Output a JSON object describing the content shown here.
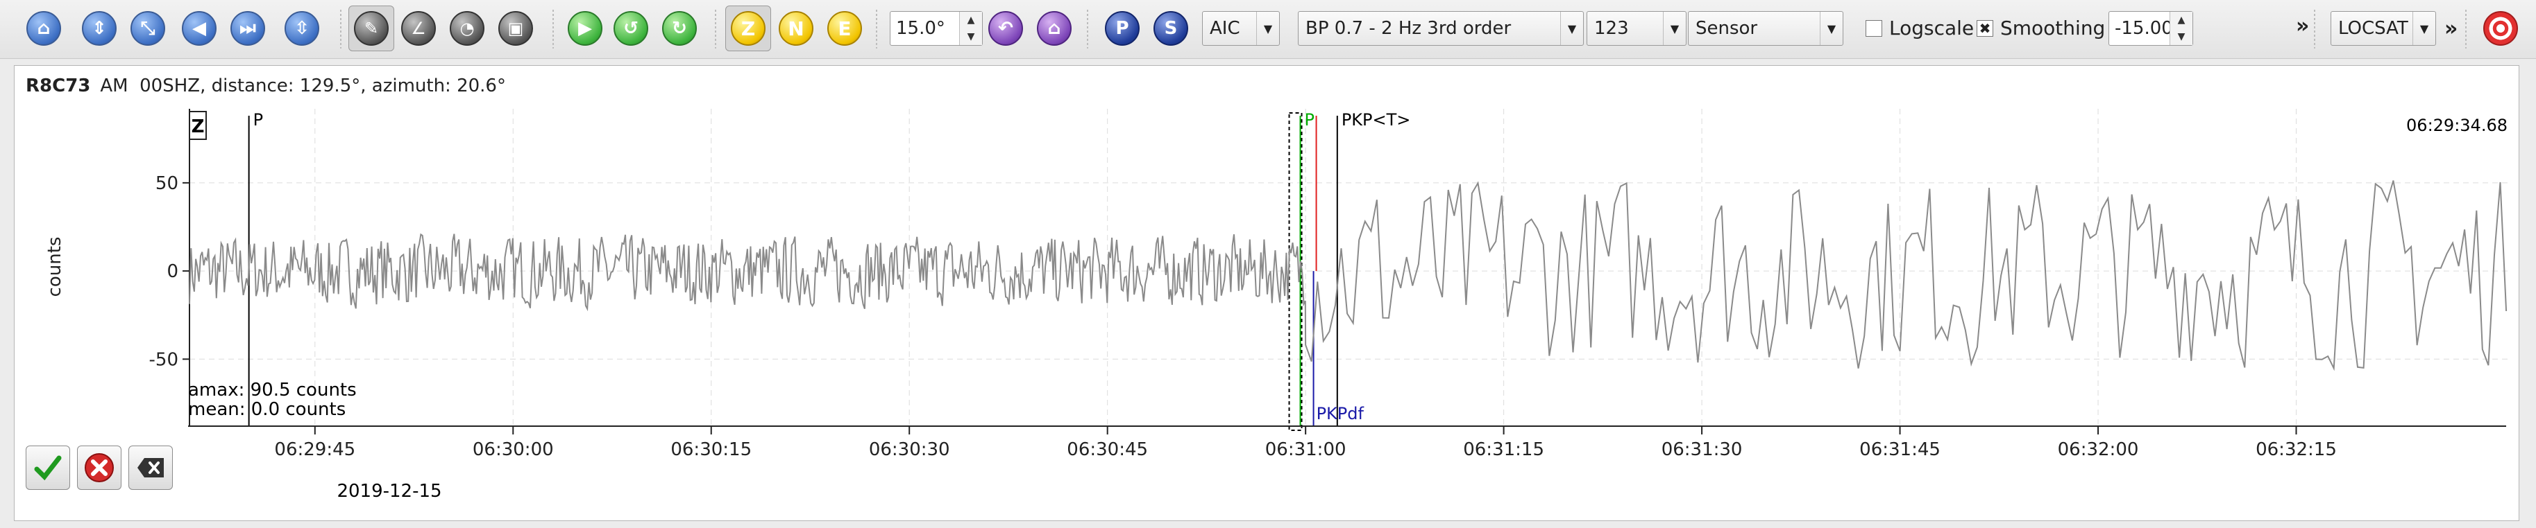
{
  "toolbar": {
    "filter_angle_value": "15.0°",
    "picker_method": "AIC",
    "filter": "BP 0.7 - 2 Hz  3rd order",
    "component_set": "123",
    "unit_mode": "Sensor",
    "logscale_label": "Logscale",
    "logscale_checked": false,
    "smoothing_label": "Smoothing",
    "smoothing_checked": true,
    "offset_value": "-15.00",
    "overflow_glyph": "»",
    "locator": "LOCSAT",
    "overflow2_glyph": "»",
    "component_buttons": [
      {
        "label": "Z",
        "active": true
      },
      {
        "label": "N",
        "active": false
      },
      {
        "label": "E",
        "active": false
      }
    ],
    "phase_buttons": [
      {
        "label": "P"
      },
      {
        "label": "S"
      }
    ]
  },
  "trace": {
    "station_code": "R8C73",
    "network": "AM",
    "channel_info": "00SHZ, distance: 129.5°, azimuth: 20.6°",
    "component_badge": "Z",
    "right_time": "06:29:34.68",
    "ylabel": "counts",
    "amax_text": "amax: 90.5 counts",
    "mean_text": "mean: 0.0 counts",
    "date_label": "2019-12-15",
    "phases": [
      {
        "name": "P",
        "time": "06:29:40.0",
        "color": "#000000",
        "position": "top"
      },
      {
        "name": "P",
        "time": "06:30:59.6",
        "color": "#00aa00",
        "position": "top"
      },
      {
        "name": "PKP<T>",
        "time": "06:31:02.4",
        "color": "#000000",
        "position": "top"
      },
      {
        "name": "PKPdf",
        "time": "06:31:00.6",
        "color": "#1a1aa8",
        "position": "bottom"
      }
    ]
  },
  "chart_data": {
    "type": "line",
    "xlabel": "",
    "ylabel": "counts",
    "x_ticks": [
      "06:29:45",
      "06:30:00",
      "06:30:15",
      "06:30:30",
      "06:30:45",
      "06:31:00",
      "06:31:15",
      "06:31:30",
      "06:31:45",
      "06:32:00",
      "06:32:15"
    ],
    "y_ticks": [
      50,
      0,
      -50
    ],
    "ylim": [
      -88,
      92
    ],
    "xlim": [
      "06:29:35.5",
      "06:32:31"
    ],
    "grid": true,
    "series": [
      {
        "name": "",
        "color": "#8a8a8a",
        "segments": [
          {
            "t_start": "06:29:35.5",
            "t_end": "06:31:00.0",
            "amplitude": 22
          },
          {
            "t_start": "06:31:00.0",
            "t_end": "06:32:31.0",
            "amplitude": 60
          }
        ]
      }
    ]
  },
  "actions": [
    {
      "name": "accept-button"
    },
    {
      "name": "reject-button"
    },
    {
      "name": "delete-button"
    }
  ]
}
